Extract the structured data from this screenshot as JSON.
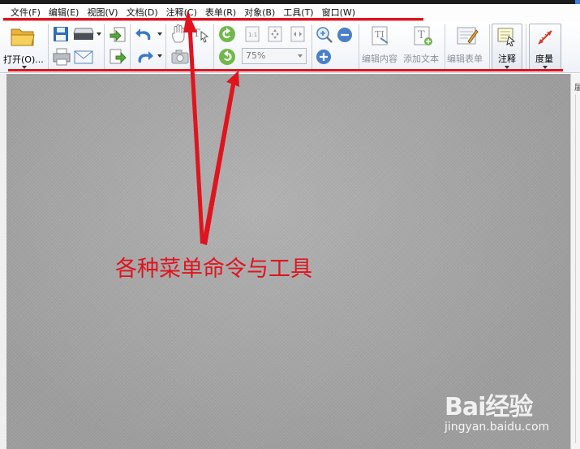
{
  "menu": {
    "items": [
      {
        "label": "文件(F)"
      },
      {
        "label": "编辑(E)"
      },
      {
        "label": "视图(V)"
      },
      {
        "label": "文档(D)"
      },
      {
        "label": "注释(C)"
      },
      {
        "label": "表单(R)"
      },
      {
        "label": "对象(B)"
      },
      {
        "label": "工具(T)"
      },
      {
        "label": "窗口(W)"
      }
    ]
  },
  "toolbar": {
    "open_label": "打开(O)...",
    "zoom_value": "75%",
    "edit_content_label": "编辑内容",
    "add_text_label": "添加文本",
    "edit_form_label": "编辑表单",
    "comment_label": "注释",
    "measure_label": "度量"
  },
  "annotation": {
    "text": "各种菜单命令与工具",
    "color": "#e0141e"
  },
  "right_panel": {
    "edge_text": "届"
  },
  "watermark": {
    "logo_text": "Bai经验",
    "site_text": "jingyan.baidu.com"
  },
  "icons": [
    "folder-open-icon",
    "save-icon",
    "scanner-icon",
    "print-icon",
    "email-icon",
    "import-icon",
    "export-icon",
    "undo-icon",
    "redo-icon",
    "hand-icon",
    "select-text-icon",
    "snapshot-icon",
    "rotate-left-icon",
    "rotate-right-icon",
    "actual-size-icon",
    "fit-page-icon",
    "fit-width-icon",
    "zoom-in-icon",
    "zoom-out-icon",
    "zoom-plus-icon",
    "edit-content-icon",
    "add-text-icon",
    "edit-form-icon",
    "comment-icon",
    "measure-icon"
  ]
}
